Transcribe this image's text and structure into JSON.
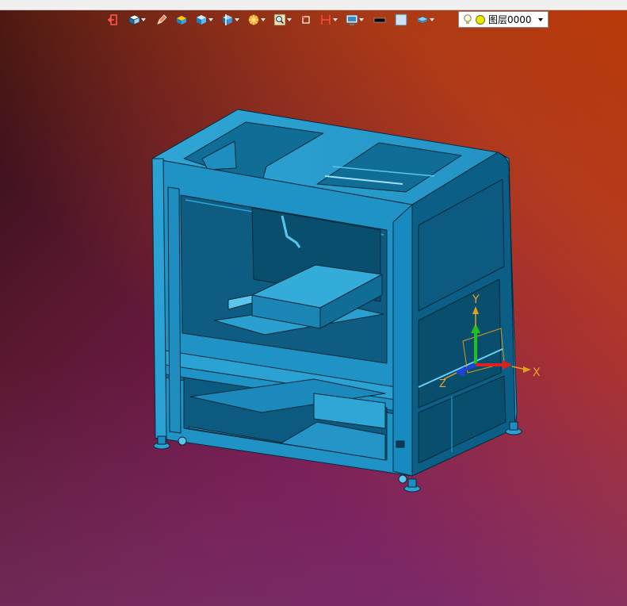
{
  "window": {
    "title": ""
  },
  "toolbar": {
    "items": [
      {
        "name": "exit-sketch-icon",
        "dropdown": false
      },
      {
        "name": "view-orientation-icon",
        "dropdown": true
      },
      {
        "name": "pencil-icon",
        "dropdown": false
      },
      {
        "name": "solid-box-icon",
        "dropdown": false
      },
      {
        "name": "shaded-cube-icon",
        "dropdown": true
      },
      {
        "name": "section-view-icon",
        "dropdown": true
      },
      {
        "name": "appearance-icon",
        "dropdown": true
      },
      {
        "name": "zoom-icon",
        "dropdown": true
      },
      {
        "name": "rotate-view-icon",
        "dropdown": false
      },
      {
        "name": "measure-icon",
        "dropdown": true
      },
      {
        "name": "display-settings-icon",
        "dropdown": true
      },
      {
        "name": "line-style-icon",
        "dropdown": false
      },
      {
        "name": "background-color-icon",
        "dropdown": false
      },
      {
        "name": "layers-icon",
        "dropdown": true
      }
    ]
  },
  "layer": {
    "current": "图层0000",
    "visible_icon": "lightbulb-icon",
    "color_icon": "yellow-dot-icon"
  },
  "triad": {
    "x_label": "X",
    "y_label": "Y",
    "z_label": "Z"
  },
  "colors": {
    "model": "#2a9fd0",
    "model_dark": "#0b5f86",
    "toolbar_text": "#000000"
  }
}
